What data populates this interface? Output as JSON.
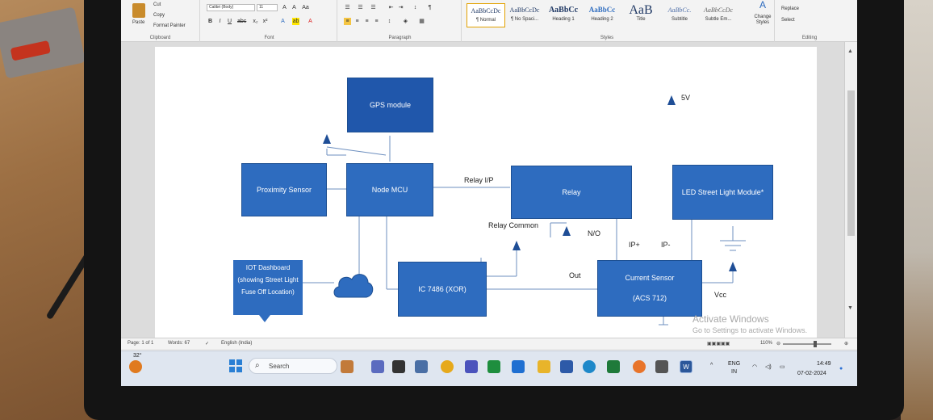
{
  "ribbon": {
    "clipboard": {
      "cut": "Cut",
      "copy": "Copy",
      "paste": "Paste",
      "format_painter": "Format Painter",
      "group": "Clipboard"
    },
    "font": {
      "name": "Calibri (Body)",
      "size": "11",
      "group": "Font"
    },
    "paragraph": {
      "group": "Paragraph"
    },
    "styles": {
      "group": "Styles",
      "items": [
        {
          "sample": "AaBbCcDc",
          "name": "¶ Normal"
        },
        {
          "sample": "AaBbCcDc",
          "name": "¶ No Spaci..."
        },
        {
          "sample": "AaBbCc",
          "name": "Heading 1"
        },
        {
          "sample": "AaBbCc",
          "name": "Heading 2"
        },
        {
          "sample": "AaB",
          "name": "Title"
        },
        {
          "sample": "AaBbCc.",
          "name": "Subtitle"
        },
        {
          "sample": "AaBbCcDc",
          "name": "Subtle Em..."
        }
      ],
      "change_styles": "Change Styles"
    },
    "editing": {
      "group": "Editing",
      "replace": "Replace",
      "select": "Select"
    }
  },
  "diagram": {
    "gps": "GPS module",
    "nodemcu": "Node MCU",
    "proximity": "Proximity Sensor",
    "relay": "Relay",
    "led": "LED Street Light Module*",
    "iot": "IOT Dashboard (showing Street Light Fuse Off Location)",
    "ic": "IC 7486 (XOR)",
    "current_title": "Current Sensor",
    "current_model": "(ACS 712)",
    "v5": "5V",
    "relay_ip": "Relay I/P",
    "relay_common": "Relay Common",
    "no": "N/O",
    "ip_plus": "IP+",
    "ip_minus": "IP-",
    "out": "Out",
    "vcc": "Vcc"
  },
  "watermark": {
    "line1": "Activate Windows",
    "line2": "Go to Settings to activate Windows."
  },
  "statusbar": {
    "page": "Page: 1 of 1",
    "words": "Words: 67",
    "language": "English (India)",
    "zoom": "110%"
  },
  "taskbar": {
    "search": "Search",
    "lang": "ENG",
    "region": "IN",
    "time": "14:49",
    "date": "07-02-2024",
    "weather": "32°"
  }
}
